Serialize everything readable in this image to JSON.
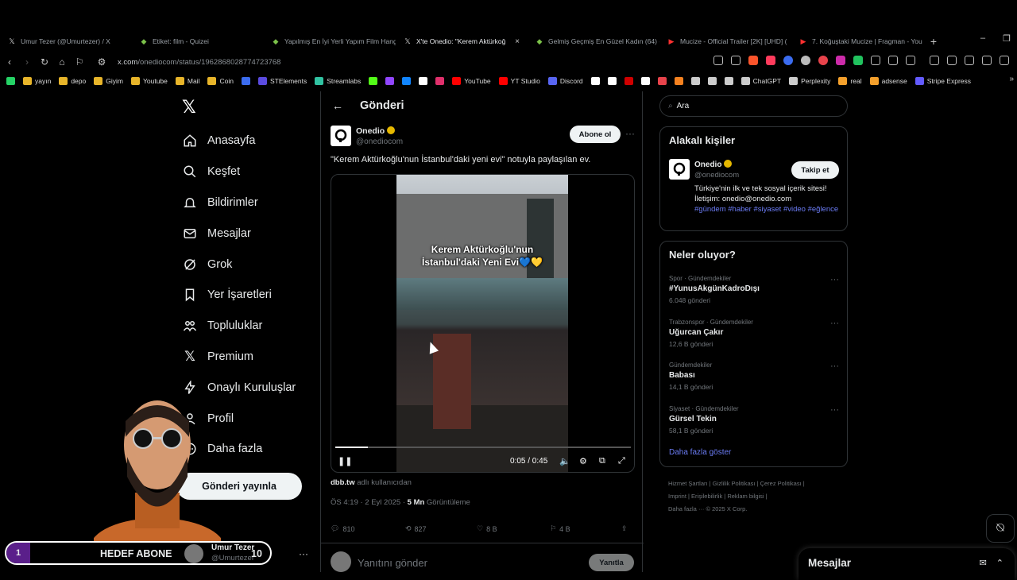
{
  "browser": {
    "tabs": [
      {
        "title": "Umur Tezer (@Umurtezer) / X",
        "favicon": "x-icon",
        "active": false
      },
      {
        "title": "Etiket: film - Quizei",
        "favicon": "quizei-icon",
        "active": false
      },
      {
        "title": "Yapılmış En İyi Yerli Yapım Film Hang",
        "favicon": "quizei-icon",
        "active": false
      },
      {
        "title": "X'te Onedio: \"Kerem Aktürkoğ",
        "favicon": "x-icon",
        "active": true,
        "close": "×"
      },
      {
        "title": "Gelmiş Geçmiş En Güzel Kadın (64) -",
        "favicon": "quizei-icon",
        "active": false
      },
      {
        "title": "Mucize - Official Trailer [2K] [UHD] (",
        "favicon": "youtube-icon",
        "active": false
      },
      {
        "title": "7. Koğuştaki Mucize | Fragman - You",
        "favicon": "youtube-icon",
        "active": false
      }
    ],
    "new_tab": "+",
    "window_controls": [
      "–",
      "❐"
    ],
    "url_host": "x.com",
    "url_path": "/onediocom/status/1962868028774723768",
    "bookmarks": [
      {
        "label": "",
        "color": "#25d366"
      },
      {
        "label": "yayın",
        "color": "#e8b52a"
      },
      {
        "label": "depo",
        "color": "#e8b52a"
      },
      {
        "label": "Giyim",
        "color": "#e8b52a"
      },
      {
        "label": "Youtube",
        "color": "#e8b52a"
      },
      {
        "label": "Mail",
        "color": "#e8b52a"
      },
      {
        "label": "Coin",
        "color": "#e8b52a"
      },
      {
        "label": "",
        "color": "#3b6cf0"
      },
      {
        "label": "STElements",
        "color": "#5b4be0"
      },
      {
        "label": "Streamlabs",
        "color": "#31c3a2"
      },
      {
        "label": "",
        "color": "#53fc18"
      },
      {
        "label": "",
        "color": "#9146ff"
      },
      {
        "label": "",
        "color": "#1185fe"
      },
      {
        "label": "",
        "color": "#ffffff"
      },
      {
        "label": "",
        "color": "#e1306c"
      },
      {
        "label": "YouTube",
        "color": "#ff0000"
      },
      {
        "label": "YT Studio",
        "color": "#ff0000"
      },
      {
        "label": "Discord",
        "color": "#5865f2"
      },
      {
        "label": "",
        "color": "#ffffff"
      },
      {
        "label": "",
        "color": "#ffffff"
      },
      {
        "label": "",
        "color": "#d00000"
      },
      {
        "label": "",
        "color": "#ffffff"
      },
      {
        "label": "",
        "color": "#e8434b"
      },
      {
        "label": "",
        "color": "#f58220"
      },
      {
        "label": "",
        "color": "#cccccc"
      },
      {
        "label": "",
        "color": "#cccccc"
      },
      {
        "label": "",
        "color": "#cccccc"
      },
      {
        "label": "ChatGPT",
        "color": "#cccccc"
      },
      {
        "label": "Perplexity",
        "color": "#cccccc"
      },
      {
        "label": "real",
        "color": "#f4a02c"
      },
      {
        "label": "adsense",
        "color": "#f4a02c"
      },
      {
        "label": "Stripe Express",
        "color": "#635bff"
      }
    ]
  },
  "nav": {
    "items": [
      {
        "label": "Anasayfa",
        "icon": "home-icon"
      },
      {
        "label": "Keşfet",
        "icon": "search-icon"
      },
      {
        "label": "Bildirimler",
        "icon": "bell-icon"
      },
      {
        "label": "Mesajlar",
        "icon": "mail-icon"
      },
      {
        "label": "Grok",
        "icon": "grok-icon"
      },
      {
        "label": "Yer İşaretleri",
        "icon": "bookmark-icon"
      },
      {
        "label": "Topluluklar",
        "icon": "communities-icon"
      },
      {
        "label": "Premium",
        "icon": "x-icon"
      },
      {
        "label": "Onaylı Kuruluşlar",
        "icon": "lightning-icon"
      },
      {
        "label": "Profil",
        "icon": "person-icon"
      },
      {
        "label": "Daha fazla",
        "icon": "more-circle-icon"
      }
    ],
    "post_button": "Gönderi yayınla"
  },
  "main": {
    "back": "←",
    "title": "Gönderi",
    "author_name": "Onedio",
    "author_handle": "@onediocom",
    "follow": "Abone ol",
    "more": "···",
    "text": "\"Kerem Aktürkoğlu'nun İstanbul'daki yeni evi\" notuyla paylaşılan ev.",
    "video_caption_line1": "Kerem Aktürkoğlu'nun",
    "video_caption_line2": "İstanbul'daki Yeni Evi💙💛",
    "video_time": "0:05 / 0:45",
    "video_progress": 0.11,
    "source_user": "dbb.tw",
    "source_suffix": " adlı kullanıcıdan",
    "timestamp": "ÖS 4:19 · 2 Eyl 2025 · ",
    "views_count": "5 Mn",
    "views_label": " Görüntüleme",
    "replies": "810",
    "reposts": "827",
    "likes": "8 B",
    "bookmarks": "4 B",
    "reply_placeholder": "Yanıtını gönder",
    "reply_button": "Yanıtla"
  },
  "sidebar": {
    "search_placeholder": "Ara",
    "related_title": "Alakalı kişiler",
    "related_name": "Onedio",
    "related_handle": "@onediocom",
    "related_follow": "Takip et",
    "related_bio": "Türkiye'nin ilk ve tek sosyal içerik sitesi! İletişim: onedio@onedio.com",
    "related_tags": "#gündem #haber #siyaset #video #eğlence",
    "trends_title": "Neler oluyor?",
    "trends": [
      {
        "category": "Spor · Gündemdekiler",
        "name": "#YunusAkgünKadroDışı",
        "count": "6.048 gönderi"
      },
      {
        "category": "Trabzonspor · Gündemdekiler",
        "name": "Uğurcan Çakır",
        "count": "12,6 B gönderi"
      },
      {
        "category": "Gündemdekiler",
        "name": "Babası",
        "count": "14,1 B gönderi"
      },
      {
        "category": "Siyaset · Gündemdekiler",
        "name": "Gürsel Tekin",
        "count": "58,1 B gönderi"
      }
    ],
    "show_more": "Daha fazla göster",
    "footer_line1": "Hizmet Şartları  |  Gizlilik Politikası  |  Çerez Politikası  |",
    "footer_line2": "Imprint  |  Erişilebilirlik  |  Reklam bilgisi  |",
    "footer_line3": "Daha fazla ···   © 2025 X Corp."
  },
  "messages_drawer": {
    "title": "Mesajlar"
  },
  "overlay": {
    "start": "1",
    "label": "HEDEF ABONE",
    "end": "10",
    "user_name": "Umur Tezer",
    "user_handle": "@Umurtezer",
    "dots": "···"
  },
  "colors": {
    "accent_link": "#6b7cf5",
    "verified": "#e6b800",
    "background": "#000000",
    "border": "#2f3336"
  }
}
